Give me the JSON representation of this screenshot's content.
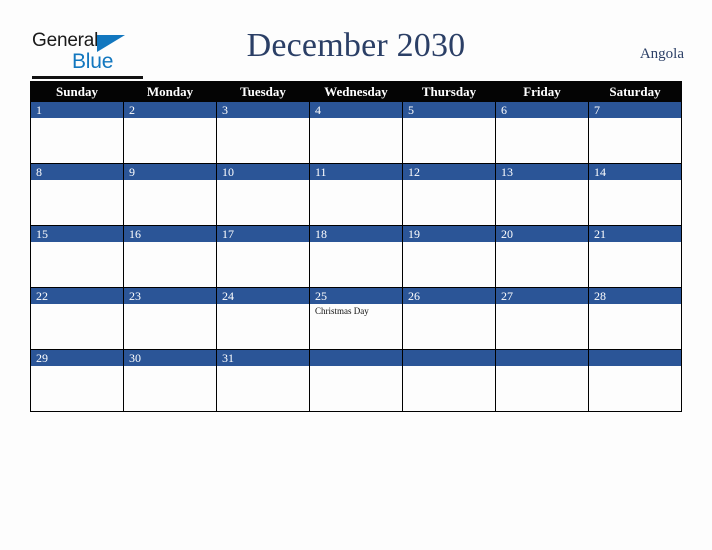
{
  "brand": {
    "word_one": "General",
    "word_two": "Blue",
    "triangle_icon": "triangle-icon",
    "accent_blue": "#1277bf"
  },
  "header": {
    "title": "December 2030",
    "country": "Angola",
    "title_color": "#2b3f66"
  },
  "calendar": {
    "header_bg": "#040404",
    "daybar_bg": "#2b5597",
    "weekdays": [
      "Sunday",
      "Monday",
      "Tuesday",
      "Wednesday",
      "Thursday",
      "Friday",
      "Saturday"
    ],
    "weeks": [
      [
        {
          "day": "1",
          "events": []
        },
        {
          "day": "2",
          "events": []
        },
        {
          "day": "3",
          "events": []
        },
        {
          "day": "4",
          "events": []
        },
        {
          "day": "5",
          "events": []
        },
        {
          "day": "6",
          "events": []
        },
        {
          "day": "7",
          "events": []
        }
      ],
      [
        {
          "day": "8",
          "events": []
        },
        {
          "day": "9",
          "events": []
        },
        {
          "day": "10",
          "events": []
        },
        {
          "day": "11",
          "events": []
        },
        {
          "day": "12",
          "events": []
        },
        {
          "day": "13",
          "events": []
        },
        {
          "day": "14",
          "events": []
        }
      ],
      [
        {
          "day": "15",
          "events": []
        },
        {
          "day": "16",
          "events": []
        },
        {
          "day": "17",
          "events": []
        },
        {
          "day": "18",
          "events": []
        },
        {
          "day": "19",
          "events": []
        },
        {
          "day": "20",
          "events": []
        },
        {
          "day": "21",
          "events": []
        }
      ],
      [
        {
          "day": "22",
          "events": []
        },
        {
          "day": "23",
          "events": []
        },
        {
          "day": "24",
          "events": []
        },
        {
          "day": "25",
          "events": [
            "Christmas Day"
          ]
        },
        {
          "day": "26",
          "events": []
        },
        {
          "day": "27",
          "events": []
        },
        {
          "day": "28",
          "events": []
        }
      ],
      [
        {
          "day": "29",
          "events": []
        },
        {
          "day": "30",
          "events": []
        },
        {
          "day": "31",
          "events": []
        },
        {
          "day": "",
          "events": []
        },
        {
          "day": "",
          "events": []
        },
        {
          "day": "",
          "events": []
        },
        {
          "day": "",
          "events": []
        }
      ]
    ]
  }
}
